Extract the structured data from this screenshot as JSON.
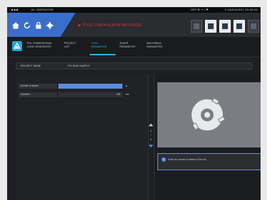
{
  "status_bar": {
    "left_glyphs": "■ ■ ■",
    "window_title": "AL OPERATOR",
    "center_info": "OFF ⚙ 〜 ! ⚑",
    "right_info": "0 16/04/2021 15:46:05"
  },
  "toolbar": {
    "alarm_text": "▶ TOOL-16004 ALARM MESSAGE",
    "icons": [
      "home-icon",
      "refresh-icon",
      "lock-icon",
      "settings-icon"
    ]
  },
  "tabs": [
    {
      "label": "POL YDIMENSIONAL\nCODE GENERATOR"
    },
    {
      "label": "PROJECT\nLIST"
    },
    {
      "label": "TOOL\nPARAMETER",
      "active": true
    },
    {
      "label": "SHAPE\nPARAMETER"
    },
    {
      "label": "MACHINING\nPARAMETER"
    }
  ],
  "project": {
    "label": "PROJECT NAME",
    "value": "TRI-SINK SAMPLE"
  },
  "parameters": [
    {
      "label": "Number of blades",
      "value": "",
      "unit": "◂▸",
      "highlight": true
    },
    {
      "label": "Diameter",
      "value": "100",
      "unit": "mm",
      "highlight": false
    }
  ],
  "pager": {
    "items": [
      "1",
      "/",
      "2"
    ]
  },
  "message": {
    "icon_glyph": "i",
    "text": "Enter the number of blades of the tool."
  },
  "colors": {
    "accent": "#29b6e6",
    "highlight": "#5a8de0",
    "alarm": "#e33131",
    "toolbar_blue": "#3b6ec9"
  }
}
